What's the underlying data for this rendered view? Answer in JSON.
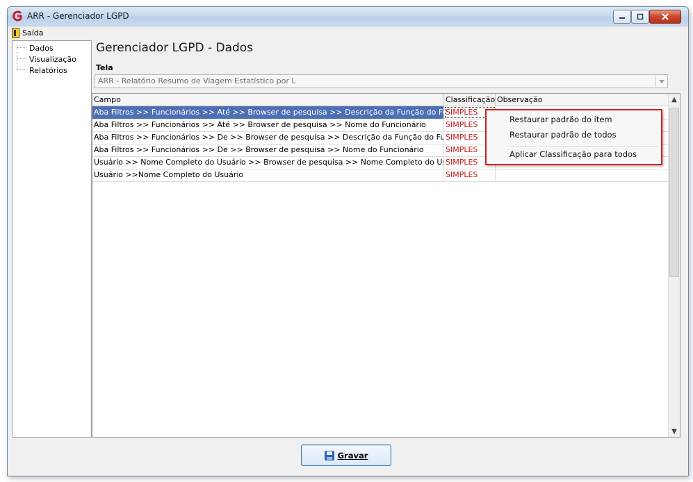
{
  "window": {
    "title": "ARR - Gerenciador LGPD",
    "app_icon": "app-logo-icon"
  },
  "menu": {
    "exit_label": "Saída"
  },
  "sidebar": {
    "items": [
      {
        "label": "Dados"
      },
      {
        "label": "Visualização"
      },
      {
        "label": "Relatórios"
      }
    ]
  },
  "main": {
    "title": "Gerenciador LGPD - Dados",
    "tela_label": "Tela",
    "tela_value": "ARR - Relatório Resumo de Viagem Estatístico por L"
  },
  "grid": {
    "columns": [
      "Campo",
      "Classificação",
      "Observação"
    ],
    "rows": [
      {
        "campo": "Aba Filtros >> Funcionários >> Até >> Browser de pesquisa >> Descrição da Função do Funcionário",
        "classificacao": "SIMPLES",
        "observacao": ""
      },
      {
        "campo": "Aba Filtros >> Funcionários >> Até >> Browser de pesquisa >> Nome do Funcionário",
        "classificacao": "SIMPLES",
        "observacao": ""
      },
      {
        "campo": "Aba Filtros >> Funcionários >> De >> Browser de pesquisa >> Descrição da Função do Funcionário",
        "classificacao": "SIMPLES",
        "observacao": ""
      },
      {
        "campo": "Aba Filtros >> Funcionários >> De >> Browser de pesquisa >> Nome do Funcionário",
        "classificacao": "SIMPLES",
        "observacao": ""
      },
      {
        "campo": "Usuário >> Nome Completo do Usuário >> Browser de pesquisa >> Nome Completo do Usuário",
        "classificacao": "SIMPLES",
        "observacao": ""
      },
      {
        "campo": "Usuário >>Nome Completo do Usuário",
        "classificacao": "SIMPLES",
        "observacao": ""
      }
    ],
    "selected_row": 0
  },
  "context_menu": {
    "items": [
      {
        "label": "Restaurar padrão do item"
      },
      {
        "label": "Restaurar padrão de todos"
      },
      {
        "label": "Aplicar Classificação para todos"
      }
    ]
  },
  "footer": {
    "save_label": "Gravar"
  },
  "colors": {
    "selection": "#4d6fb3",
    "classification_text": "#c71818",
    "context_menu_highlight_border": "#d42020"
  }
}
